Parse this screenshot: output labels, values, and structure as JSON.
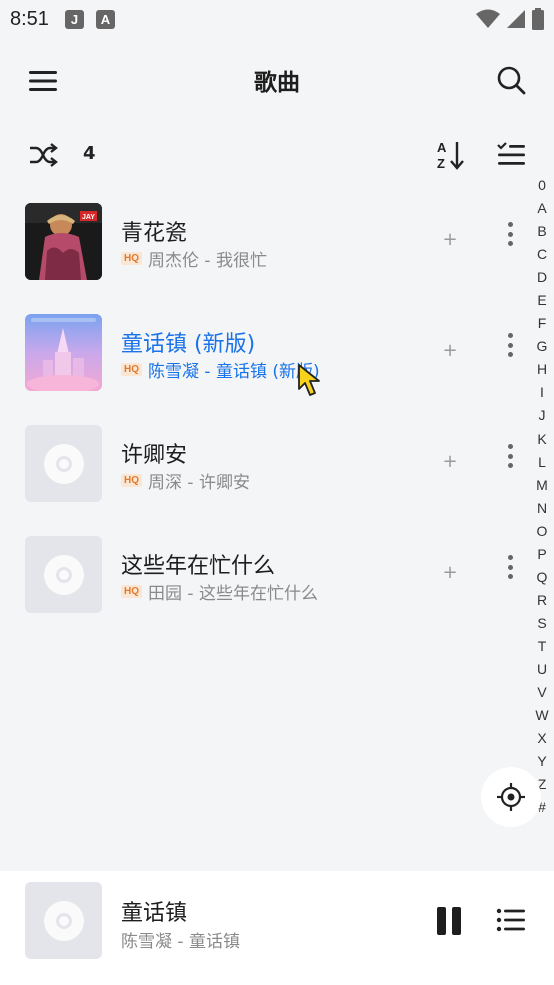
{
  "status_bar": {
    "time": "8:51",
    "notifications": [
      {
        "glyph": "J",
        "icon": "app-j-icon"
      },
      {
        "glyph": "A",
        "icon": "app-a-icon"
      }
    ]
  },
  "header": {
    "title": "歌曲"
  },
  "toolbar": {
    "song_count": "4"
  },
  "songs": [
    {
      "title": "青花瓷",
      "quality": "HQ",
      "artist_album": "周杰伦 - 我很忙",
      "add": "+",
      "cover": "album-art"
    },
    {
      "title": "童话镇 (新版)",
      "quality": "HQ",
      "artist_album": "陈雪凝 - 童话镇 (新版)",
      "add": "+",
      "cover": "album-art",
      "playing": true
    },
    {
      "title": "许卿安",
      "quality": "HQ",
      "artist_album": "周深 - 许卿安",
      "add": "+",
      "cover": "placeholder-disc"
    },
    {
      "title": "这些年在忙什么",
      "quality": "HQ",
      "artist_album": "田园 - 这些年在忙什么",
      "add": "+",
      "cover": "placeholder-disc"
    }
  ],
  "alpha_index": [
    "0",
    "A",
    "B",
    "C",
    "D",
    "E",
    "F",
    "G",
    "H",
    "I",
    "J",
    "K",
    "L",
    "M",
    "N",
    "O",
    "P",
    "Q",
    "R",
    "S",
    "T",
    "U",
    "V",
    "W",
    "X",
    "Y",
    "Z",
    "#"
  ],
  "cover_text": {
    "jay_badge": "JAY"
  },
  "player": {
    "title": "童话镇",
    "subtitle": "陈雪凝 - 童话镇"
  },
  "colors": {
    "accent": "#1a73e8",
    "background": "#f4f5f7",
    "hq_badge": "#e07a2e"
  }
}
